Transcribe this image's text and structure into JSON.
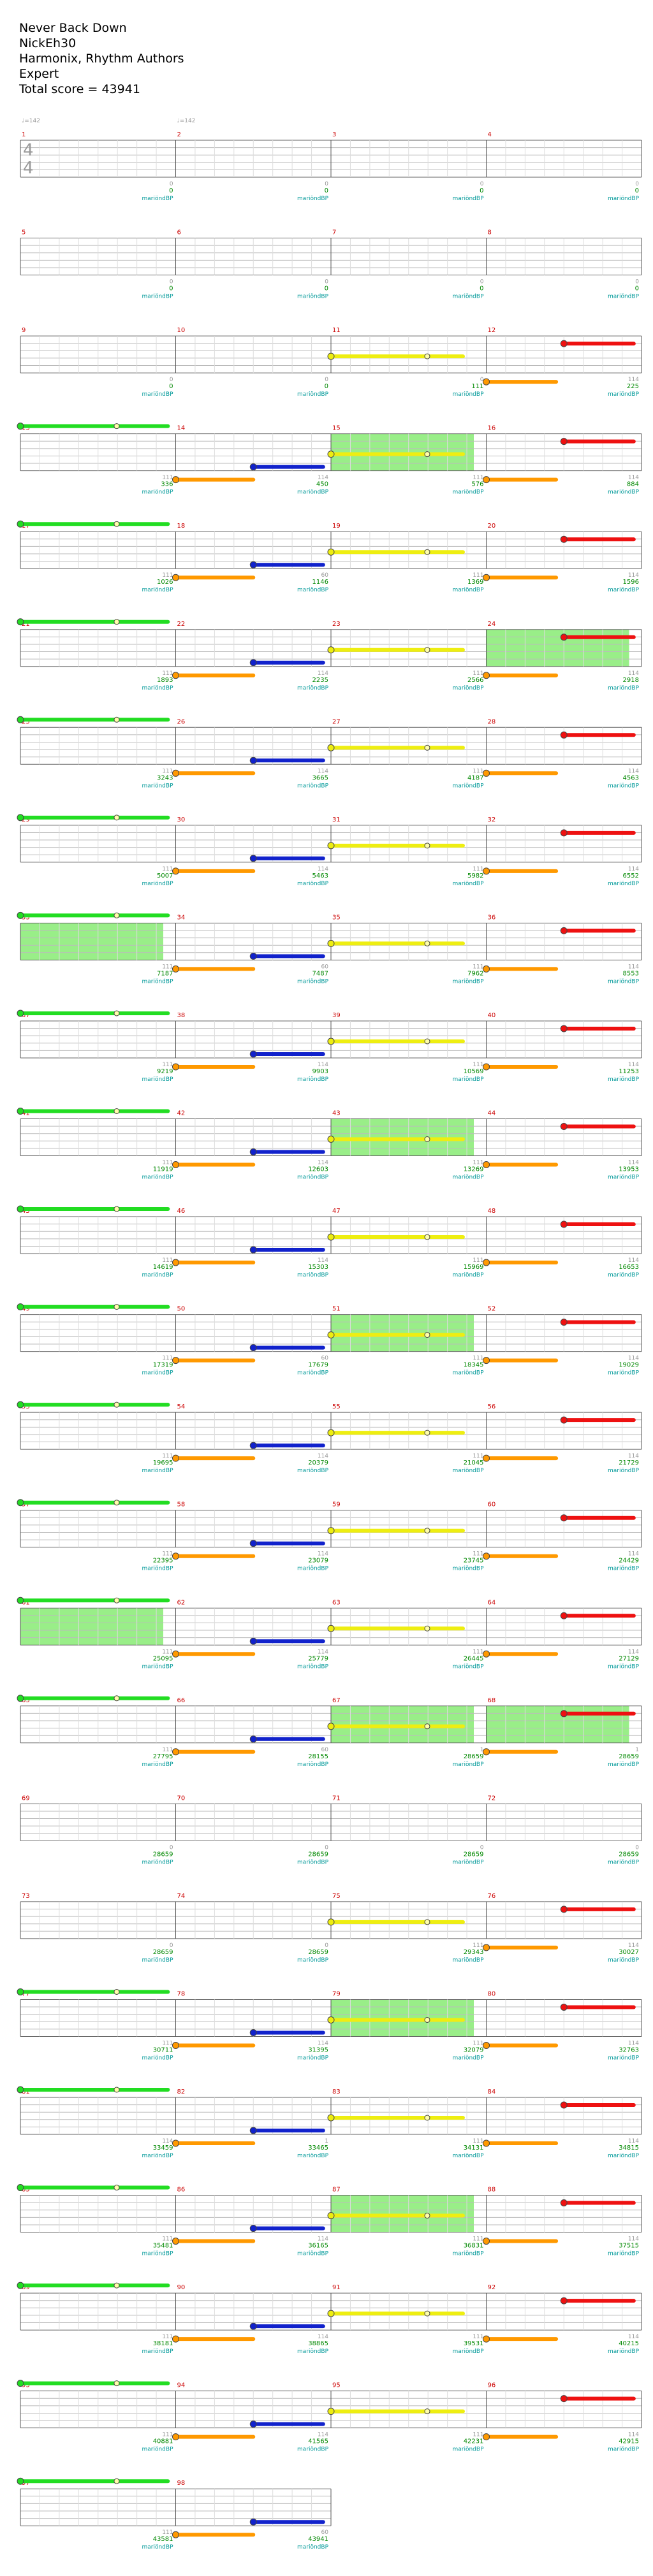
{
  "song": {
    "title": "Never Back Down",
    "charter": "NickEh30",
    "authors": "Harmonix, Rhythm Authors",
    "difficulty": "Expert",
    "total_label": "Total score = 43941"
  },
  "tempo_markers": [
    {
      "measure": 1,
      "label": "♩=142"
    },
    {
      "measure": 2,
      "label": "♩=142"
    }
  ],
  "time_signature": {
    "top": "4",
    "bottom": "4"
  },
  "pattern_label": "mariöndBP",
  "colors": {
    "green": "#22dd22",
    "red": "#ee1111",
    "yellow": "#eeee11",
    "blue": "#1122cc",
    "orange": "#ff9900",
    "overdrive": "#99ee88",
    "measure_number": "#cc0000",
    "score": "#008800",
    "pattern": "#009999",
    "streak": "#999999"
  },
  "measures": [
    {
      "n": 1,
      "score": 0,
      "streak": 0
    },
    {
      "n": 2,
      "score": 0,
      "streak": 0
    },
    {
      "n": 3,
      "score": 0,
      "streak": 0
    },
    {
      "n": 4,
      "score": 0,
      "streak": 0
    },
    {
      "n": 5,
      "score": 0,
      "streak": 0
    },
    {
      "n": 6,
      "score": 0,
      "streak": 0
    },
    {
      "n": 7,
      "score": 0,
      "streak": 0
    },
    {
      "n": 8,
      "score": 0,
      "streak": 0
    },
    {
      "n": 9,
      "score": 0,
      "streak": 0
    },
    {
      "n": 10,
      "score": 0,
      "streak": 0
    },
    {
      "n": 11,
      "score": 111,
      "streak": 0
    },
    {
      "n": 12,
      "score": 225,
      "streak": 114
    },
    {
      "n": 13,
      "score": 336,
      "streak": 111
    },
    {
      "n": 14,
      "score": 450,
      "streak": 114
    },
    {
      "n": 15,
      "score": 576,
      "streak": 111
    },
    {
      "n": 16,
      "score": 884,
      "streak": 114
    },
    {
      "n": 17,
      "score": 1026,
      "streak": 111
    },
    {
      "n": 18,
      "score": 1146,
      "streak": 60
    },
    {
      "n": 19,
      "score": 1369,
      "streak": 111
    },
    {
      "n": 20,
      "score": 1596,
      "streak": 114
    },
    {
      "n": 21,
      "score": 1893,
      "streak": 111
    },
    {
      "n": 22,
      "score": 2235,
      "streak": 114
    },
    {
      "n": 23,
      "score": 2566,
      "streak": 111
    },
    {
      "n": 24,
      "score": 2918,
      "streak": 114
    },
    {
      "n": 25,
      "score": 3243,
      "streak": 111
    },
    {
      "n": 26,
      "score": 3665,
      "streak": 114
    },
    {
      "n": 27,
      "score": 4187,
      "streak": 111
    },
    {
      "n": 28,
      "score": 4563,
      "streak": 114
    },
    {
      "n": 29,
      "score": 5007,
      "streak": 111
    },
    {
      "n": 30,
      "score": 5463,
      "streak": 114
    },
    {
      "n": 31,
      "score": 5982,
      "streak": 111
    },
    {
      "n": 32,
      "score": 6552,
      "streak": 114
    },
    {
      "n": 33,
      "score": 7187,
      "streak": 111
    },
    {
      "n": 34,
      "score": 7487,
      "streak": 60
    },
    {
      "n": 35,
      "score": 7962,
      "streak": 111
    },
    {
      "n": 36,
      "score": 8553,
      "streak": 114
    },
    {
      "n": 37,
      "score": 9219,
      "streak": 111
    },
    {
      "n": 38,
      "score": 9903,
      "streak": 114
    },
    {
      "n": 39,
      "score": 10569,
      "streak": 111
    },
    {
      "n": 40,
      "score": 11253,
      "streak": 114
    },
    {
      "n": 41,
      "score": 11919,
      "streak": 111
    },
    {
      "n": 42,
      "score": 12603,
      "streak": 114
    },
    {
      "n": 43,
      "score": 13269,
      "streak": 111
    },
    {
      "n": 44,
      "score": 13953,
      "streak": 114
    },
    {
      "n": 45,
      "score": 14619,
      "streak": 111
    },
    {
      "n": 46,
      "score": 15303,
      "streak": 114
    },
    {
      "n": 47,
      "score": 15969,
      "streak": 111
    },
    {
      "n": 48,
      "score": 16653,
      "streak": 114
    },
    {
      "n": 49,
      "score": 17319,
      "streak": 111
    },
    {
      "n": 50,
      "score": 17679,
      "streak": 60
    },
    {
      "n": 51,
      "score": 18345,
      "streak": 111
    },
    {
      "n": 52,
      "score": 19029,
      "streak": 114
    },
    {
      "n": 53,
      "score": 19695,
      "streak": 111
    },
    {
      "n": 54,
      "score": 20379,
      "streak": 114
    },
    {
      "n": 55,
      "score": 21045,
      "streak": 111
    },
    {
      "n": 56,
      "score": 21729,
      "streak": 114
    },
    {
      "n": 57,
      "score": 22395,
      "streak": 111
    },
    {
      "n": 58,
      "score": 23079,
      "streak": 114
    },
    {
      "n": 59,
      "score": 23745,
      "streak": 111
    },
    {
      "n": 60,
      "score": 24429,
      "streak": 114
    },
    {
      "n": 61,
      "score": 25095,
      "streak": 111
    },
    {
      "n": 62,
      "score": 25779,
      "streak": 114
    },
    {
      "n": 63,
      "score": 26445,
      "streak": 111
    },
    {
      "n": 64,
      "score": 27129,
      "streak": 114
    },
    {
      "n": 65,
      "score": 27795,
      "streak": 111
    },
    {
      "n": 66,
      "score": 28155,
      "streak": 60
    },
    {
      "n": 67,
      "score": 28659,
      "streak": 1
    },
    {
      "n": 68,
      "score": 28659,
      "streak": 1
    },
    {
      "n": 69,
      "score": 28659,
      "streak": 0
    },
    {
      "n": 70,
      "score": 28659,
      "streak": 0
    },
    {
      "n": 71,
      "score": 28659,
      "streak": 0
    },
    {
      "n": 72,
      "score": 28659,
      "streak": 0
    },
    {
      "n": 73,
      "score": 28659,
      "streak": 0
    },
    {
      "n": 74,
      "score": 28659,
      "streak": 0
    },
    {
      "n": 75,
      "score": 29343,
      "streak": 111
    },
    {
      "n": 76,
      "score": 30027,
      "streak": 114
    },
    {
      "n": 77,
      "score": 30711,
      "streak": 111
    },
    {
      "n": 78,
      "score": 31395,
      "streak": 114
    },
    {
      "n": 79,
      "score": 32079,
      "streak": 111
    },
    {
      "n": 80,
      "score": 32763,
      "streak": 114
    },
    {
      "n": 81,
      "score": 33459,
      "streak": 114
    },
    {
      "n": 82,
      "score": 33465,
      "streak": 1
    },
    {
      "n": 83,
      "score": 34131,
      "streak": 111
    },
    {
      "n": 84,
      "score": 34815,
      "streak": 114
    },
    {
      "n": 85,
      "score": 35481,
      "streak": 111
    },
    {
      "n": 86,
      "score": 36165,
      "streak": 114
    },
    {
      "n": 87,
      "score": 36831,
      "streak": 111
    },
    {
      "n": 88,
      "score": 37515,
      "streak": 114
    },
    {
      "n": 89,
      "score": 38181,
      "streak": 111
    },
    {
      "n": 90,
      "score": 38865,
      "streak": 114
    },
    {
      "n": 91,
      "score": 39531,
      "streak": 111
    },
    {
      "n": 92,
      "score": 40215,
      "streak": 114
    },
    {
      "n": 93,
      "score": 40881,
      "streak": 111
    },
    {
      "n": 94,
      "score": 41565,
      "streak": 114
    },
    {
      "n": 95,
      "score": 42231,
      "streak": 111
    },
    {
      "n": 96,
      "score": 42915,
      "streak": 114
    },
    {
      "n": 97,
      "score": 43581,
      "streak": 111
    },
    {
      "n": 98,
      "score": 43941,
      "streak": 60
    }
  ],
  "overdrive_measures": [
    15,
    24,
    33,
    43,
    51,
    61,
    67,
    68,
    79,
    87
  ],
  "note_pattern": [
    {
      "color": "green",
      "start": 0.0,
      "end": 0.95,
      "star_at": 0.62
    },
    {
      "color": "orange",
      "start": 0.0,
      "end": 0.5
    },
    {
      "color": "blue",
      "start": 0.5,
      "end": 0.95
    },
    {
      "color": "yellow",
      "start": 0.0,
      "end": 0.85,
      "star_at": 0.62
    },
    {
      "color": "orange",
      "start": 0.0,
      "end": 0.45
    },
    {
      "color": "red",
      "start": 0.5,
      "end": 0.95
    }
  ],
  "noted_measure_ranges": [
    [
      11,
      68
    ],
    [
      75,
      98
    ]
  ]
}
